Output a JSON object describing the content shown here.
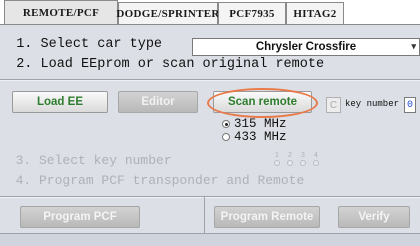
{
  "tabs": [
    {
      "label": "REMOTE/PCF",
      "active": true
    },
    {
      "label": "DODGE/SPRINTER",
      "active": false
    },
    {
      "label": "PCF7935",
      "active": false
    },
    {
      "label": "HITAG2",
      "active": false
    }
  ],
  "steps": {
    "step1": "  1. Select car type",
    "step2": "  2. Load EEprom or scan original remote",
    "step3": "  3. Select key number",
    "step4": "  4. Program PCF transponder and Remote"
  },
  "car_type": {
    "selected": "Chrysler Crossfire",
    "arrow_icon": "dropdown-arrow-icon"
  },
  "buttons": {
    "load_ee": "Load EE",
    "editor": "Editor",
    "scan_remote": "Scan remote",
    "program_pcf": "Program PCF",
    "program_remote": "Program Remote",
    "verify": "Verify"
  },
  "key": {
    "c_label": "C",
    "label": "key number",
    "value": "0"
  },
  "frequency": {
    "options": [
      "315 MHz",
      "433 MHz"
    ],
    "selected": "315 MHz"
  },
  "key_select": [
    "1",
    "2",
    "3",
    "4"
  ],
  "colors": {
    "panel": "#dcdfe6",
    "highlight": "#e87a4a",
    "green_text": "#2e7d2e",
    "disabled_text": "#aeb1b8"
  }
}
